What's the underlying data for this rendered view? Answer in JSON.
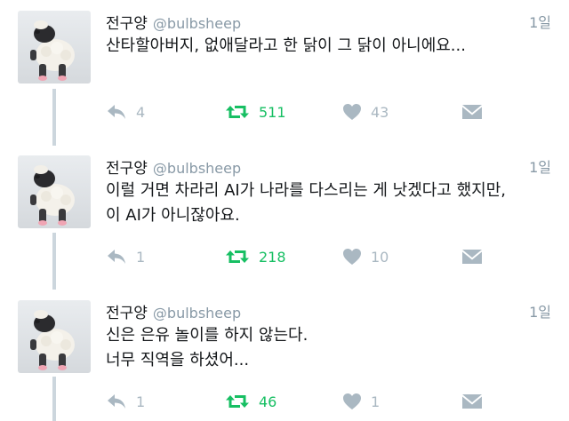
{
  "tweets": [
    {
      "display_name": "전구양",
      "handle": "@bulbsheep",
      "time": "1일",
      "lines": [
        "산타할아버지, 없애달라고 한 닭이 그 닭이 아니에요..."
      ],
      "reply_count": "4",
      "retweet_count": "511",
      "like_count": "43",
      "avatar_icon": "sheep-plush-avatar",
      "reply_icon": "reply-arrow-icon",
      "retweet_icon": "retweet-arrows-icon",
      "like_icon": "heart-icon",
      "dm_icon": "envelope-icon"
    },
    {
      "display_name": "전구양",
      "handle": "@bulbsheep",
      "time": "1일",
      "lines": [
        "이럴 거면 차라리 AI가 나라를 다스리는 게 낫겠다고 했지만,",
        "이 AI가 아니잖아요."
      ],
      "reply_count": "1",
      "retweet_count": "218",
      "like_count": "10",
      "avatar_icon": "sheep-plush-avatar",
      "reply_icon": "reply-arrow-icon",
      "retweet_icon": "retweet-arrows-icon",
      "like_icon": "heart-icon",
      "dm_icon": "envelope-icon"
    },
    {
      "display_name": "전구양",
      "handle": "@bulbsheep",
      "time": "1일",
      "lines": [
        "신은 은유 놀이를 하지 않는다.",
        "너무 직역을 하셨어..."
      ],
      "reply_count": "1",
      "retweet_count": "46",
      "like_count": "1",
      "avatar_icon": "sheep-plush-avatar",
      "reply_icon": "reply-arrow-icon",
      "retweet_icon": "retweet-arrows-icon",
      "like_icon": "heart-icon",
      "dm_icon": "envelope-icon"
    }
  ],
  "colors": {
    "text": "#14171a",
    "muted": "#8899a6",
    "icon": "#aab8c2",
    "retweet_green": "#17bf63",
    "thread_line": "#ccd6dd"
  }
}
